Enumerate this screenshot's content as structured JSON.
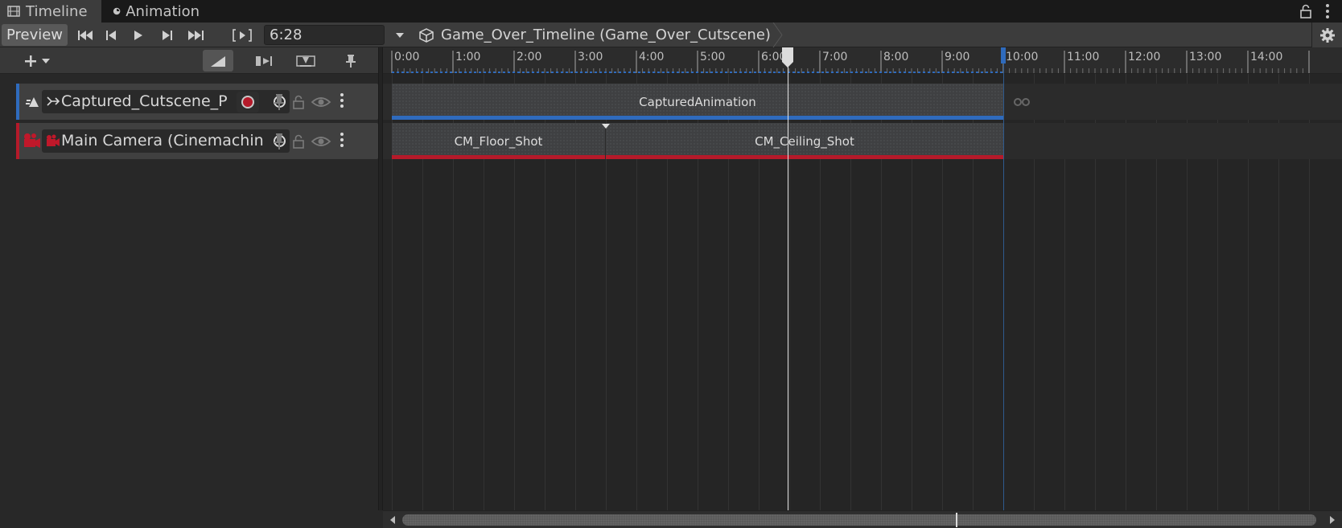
{
  "tabs": [
    {
      "label": "Timeline",
      "icon": "filmstrip-icon",
      "active": true
    },
    {
      "label": "Animation",
      "icon": "clock-icon",
      "active": false
    }
  ],
  "toolbar": {
    "preview_label": "Preview",
    "current_time": "6:28",
    "breadcrumb": "Game_Over_Timeline (Game_Over_Cutscene)"
  },
  "ruler": {
    "ticks": [
      "0:00",
      "1:00",
      "2:00",
      "3:00",
      "4:00",
      "5:00",
      "6:00",
      "7:00",
      "8:00",
      "9:00",
      "10:00",
      "11:00",
      "12:00",
      "13:00",
      "14:00"
    ]
  },
  "tracks": [
    {
      "name": "Captured_Cutscene_P",
      "kind": "animation",
      "color": "#2f6bbd",
      "clips": [
        {
          "label": "CapturedAnimation",
          "start": 0,
          "end": 10.0
        }
      ]
    },
    {
      "name": "Main Camera (Cinemachin",
      "kind": "cinemachine",
      "color": "#b51a2a",
      "clips": [
        {
          "label": "CM_Floor_Shot",
          "start": 0,
          "end": 3.5
        },
        {
          "label": "CM_Ceiling_Shot",
          "start": 3.5,
          "end": 10.0
        }
      ]
    }
  ],
  "playhead_minutes": 6.47,
  "timeline_end_minutes": 10.0,
  "colors": {
    "accent_blue": "#2f6bbd",
    "accent_red": "#b51a2a"
  }
}
